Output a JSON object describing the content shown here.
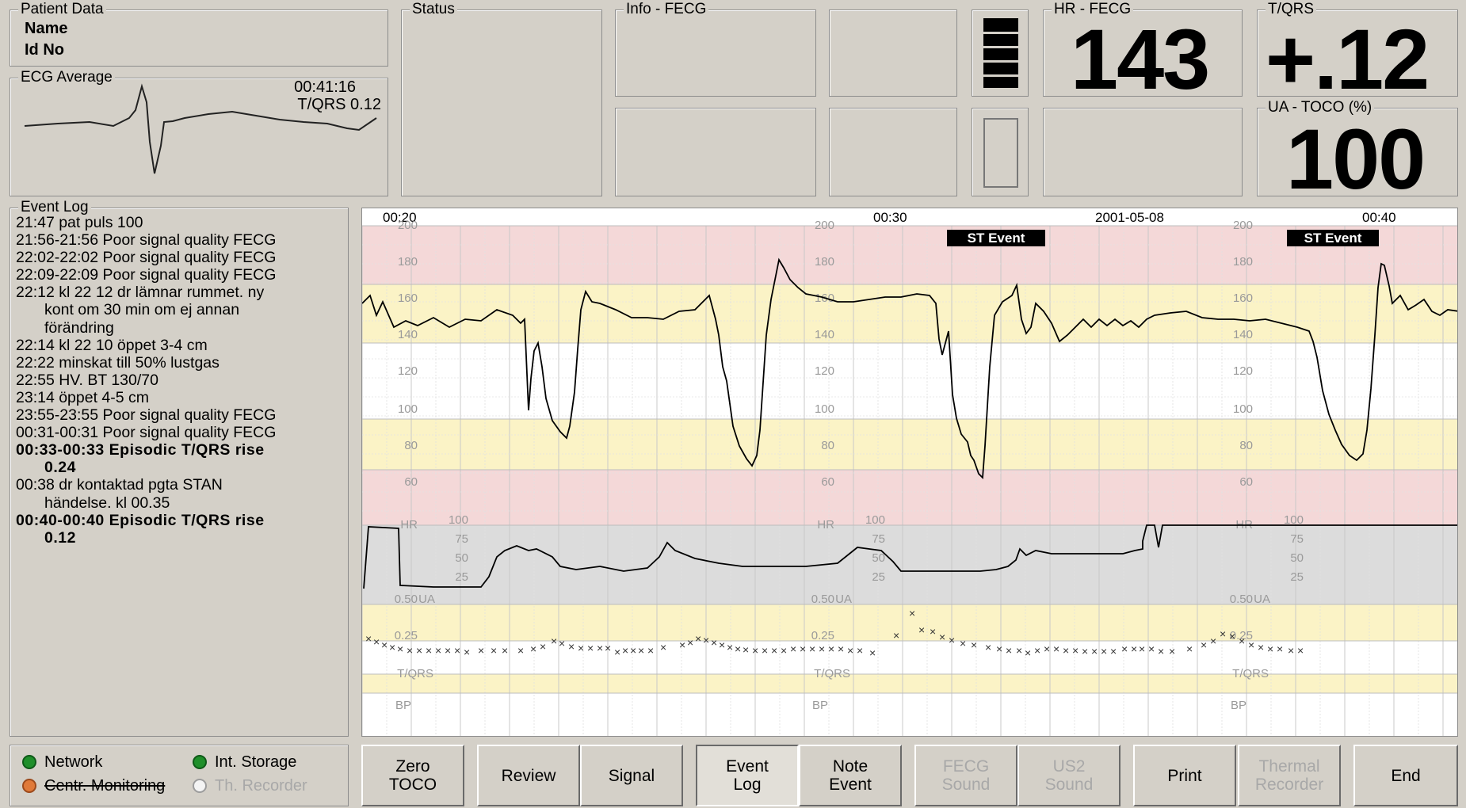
{
  "patient": {
    "title": "Patient Data",
    "name_label": "Name",
    "id_label": "Id No"
  },
  "status": {
    "title": "Status"
  },
  "info": {
    "title": "Info - FECG"
  },
  "hr": {
    "title": "HR - FECG",
    "value": "143"
  },
  "tqrs": {
    "title": "T/QRS",
    "value": "+.12"
  },
  "ua": {
    "title": "UA - TOCO (%)",
    "value": "100"
  },
  "ecg_avg": {
    "title": "ECG Average",
    "time": "00:41:16",
    "tqrs": "T/QRS 0.12"
  },
  "event_log": {
    "title": "Event Log",
    "lines": [
      "21:47 pat puls 100",
      "21:56-21:56 Poor signal quality FECG",
      "22:02-22:02 Poor signal quality FECG",
      "22:09-22:09 Poor signal quality FECG",
      "22:12 kl 22 12 dr lämnar rummet. ny",
      "kont om 30 min om ej annan",
      "förändring",
      "22:14 kl 22 10 öppet 3-4 cm",
      "22:22 minskat till 50% lustgas",
      "22:55 HV. BT 130/70",
      "23:14 öppet 4-5 cm",
      "23:55-23:55 Poor signal quality FECG",
      "00:31-00:31 Poor signal quality FECG",
      "00:33-00:33 Episodic T/QRS rise",
      "0.24",
      "00:38 dr kontaktad pgta STAN",
      "händelse. kl 00.35",
      "00:40-00:40 Episodic T/QRS rise",
      "0.12"
    ]
  },
  "chart": {
    "time_labels": [
      "00:20",
      "00:30",
      "2001-05-08",
      "00:40"
    ],
    "st_event_label": "ST Event",
    "hr_ticks": [
      "200",
      "180",
      "160",
      "140",
      "120",
      "100",
      "80",
      "60"
    ],
    "hr_label": "HR",
    "ua_ticks": [
      "100",
      "75",
      "50",
      "25"
    ],
    "ua_label": "UA",
    "tqrs_ticks": [
      "0.50",
      "0.25"
    ],
    "tqrs_label": "T/QRS",
    "bp_label": "BP"
  },
  "indicators": {
    "network": "Network",
    "storage": "Int. Storage",
    "central": "Centr. Monitoring",
    "recorder": "Th. Recorder",
    "colors": {
      "ok": "#1f8f2a",
      "warn": "#e07a3a",
      "off": "#f4f4f4"
    }
  },
  "buttons": {
    "zero_toco": "Zero\nTOCO",
    "review": "Review",
    "signal": "Signal",
    "event_log": "Event\nLog",
    "note_event": "Note\nEvent",
    "fecg_sound": "FECG\nSound",
    "us2_sound": "US2\nSound",
    "print": "Print",
    "thermal_recorder": "Thermal\nRecorder",
    "end": "End"
  }
}
